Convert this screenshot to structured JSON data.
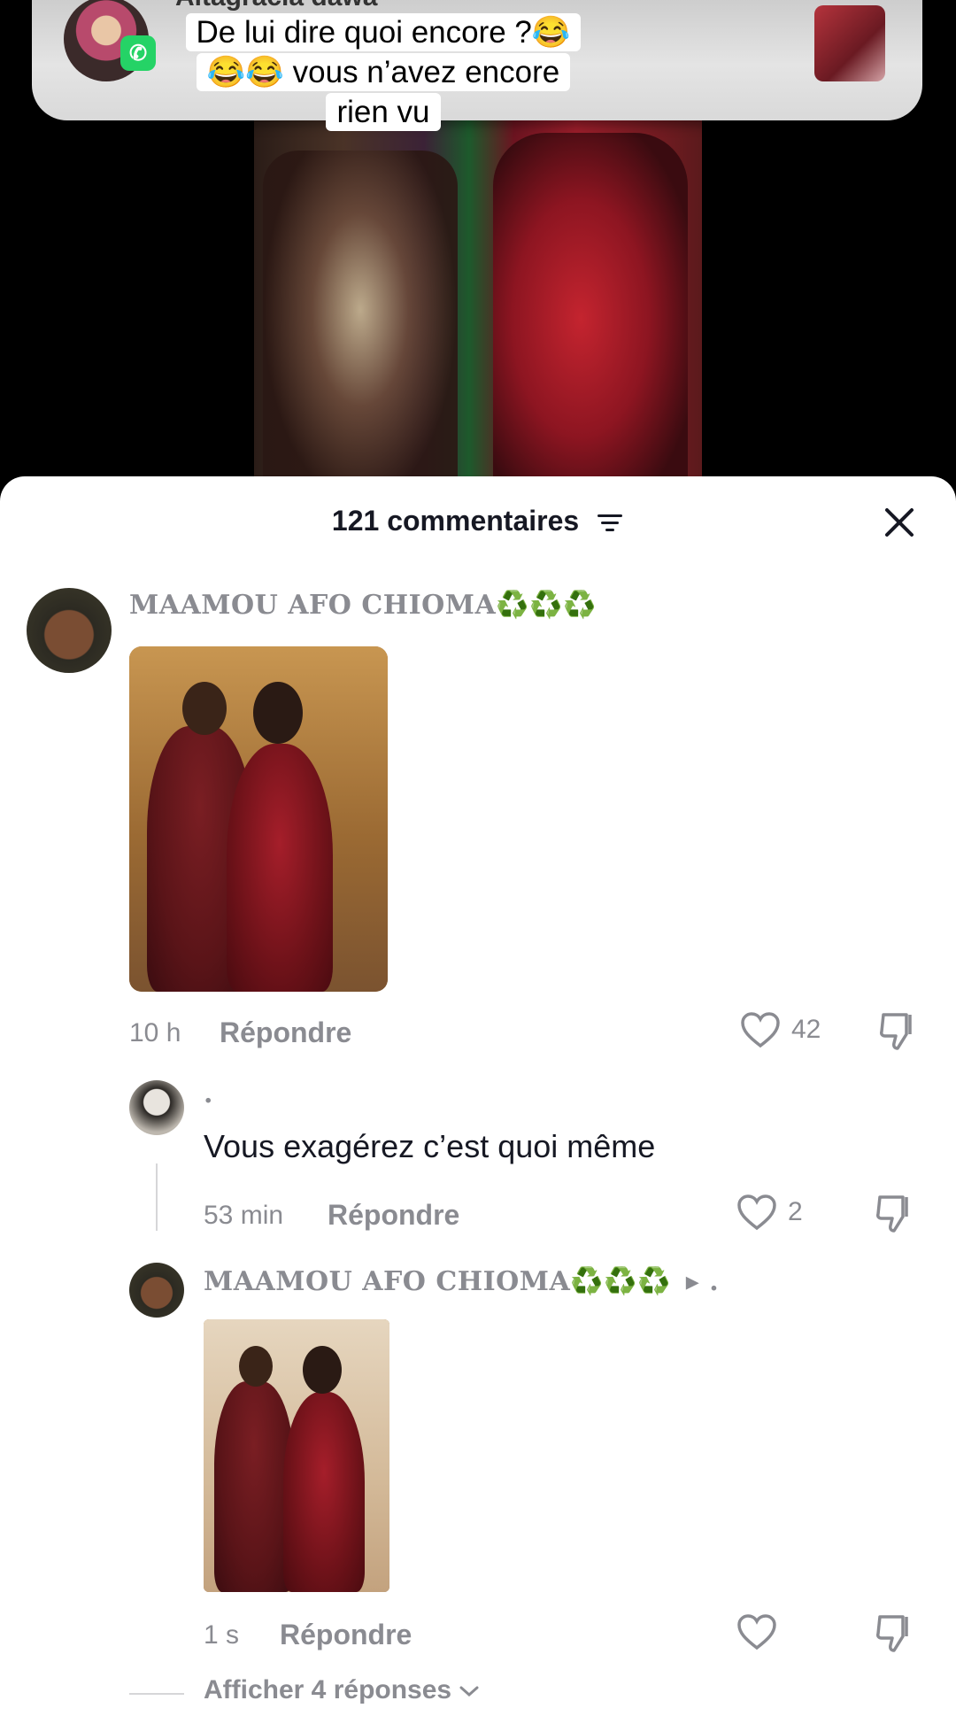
{
  "notification": {
    "sender_name": "Altagracia dawa",
    "app_icon": "whatsapp-icon"
  },
  "video": {
    "caption_lines": [
      "De lui dire quoi encore ?😂",
      "😂😂 vous n’avez encore",
      "rien vu"
    ]
  },
  "comments_sheet": {
    "title": "121 commentaires",
    "filter_icon": "filter-icon",
    "close_icon": "close-icon"
  },
  "comments": [
    {
      "username": "MAAMOU AFO CHIOMA",
      "badges": "♻️♻️♻️",
      "time": "10 h",
      "reply_label": "Répondre",
      "likes": "42"
    },
    {
      "username": ".",
      "text": "Vous exagérez c’est quoi même",
      "time": "53 min",
      "reply_label": "Répondre",
      "likes": "2"
    },
    {
      "username": "MAAMOU AFO CHIOMA",
      "badges": "♻️♻️♻️",
      "reply_to_arrow": "▸",
      "reply_to": ".",
      "time": "1 s",
      "reply_label": "Répondre",
      "likes": ""
    }
  ],
  "show_replies": "Afficher 4 réponses",
  "colors": {
    "accent_green": "#25d366",
    "muted_text": "#8a8b91",
    "primary_text": "#161823"
  }
}
